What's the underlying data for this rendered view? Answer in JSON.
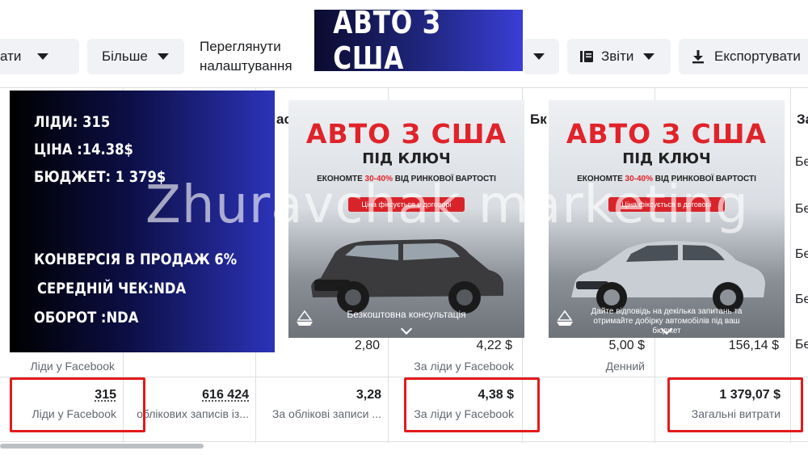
{
  "toolbar": {
    "edit_partial": "ати",
    "more_label": "Більше",
    "view_settings": "Переглянути налаштування",
    "reports_label": "Звіти",
    "export_label": "Експортувати"
  },
  "banner": {
    "title": "АВТО З США"
  },
  "stats": {
    "leads": "ЛІДИ: 315",
    "price": "ЦІНА :14.38$",
    "budget": "БЮДЖЕТ: 1 379$",
    "conversion": "КОНВЕРСІЯ В ПРОДАЖ 6%",
    "avg_check": "СЕРЕДНІЙ ЧЕК:NDA",
    "turnover": "ОБОРОТ :NDA"
  },
  "ads": [
    {
      "title": "АВТО З США",
      "subtitle": "ПІД КЛЮЧ",
      "econ_prefix": "ЕКОНОМТЕ ",
      "econ_pct": "30-40%",
      "econ_suffix": " ВІД РИНКОВОЇ ВАРТОСТІ",
      "pill": "Ціна фіксується в договорі",
      "caption": "Безкоштовна консультація",
      "logo": "GLOBAL",
      "car_color": "#3b3b3d"
    },
    {
      "title": "АВТО З США",
      "subtitle": "ПІД КЛЮЧ",
      "econ_prefix": "ЕКОНОМТЕ ",
      "econ_pct": "30-40%",
      "econ_suffix": " ВІД РИНКОВОЇ ВАРТОСТІ",
      "pill": "Ціна фіксується в договорі",
      "caption": "Дайте відповідь на декілька запитань та отримайте добірку автомобілів під ваш бюджет",
      "logo": "GLOBAL",
      "car_color": "#c9ced4"
    }
  ],
  "watermark": "Zhuravchak marketing",
  "table": {
    "headers": {
      "col2_partial": "ас",
      "col4_partial": "Бк",
      "col7_partial": "За"
    },
    "side_rows": [
      "Бе",
      "Бе",
      "Бе",
      "Бе",
      "Бе"
    ],
    "row_last": {
      "leads_label": "Ліди у Facebook",
      "freq": "2,80",
      "cpl": "4,22 $",
      "cpl_label": "За ліди у Facebook",
      "budget": "5,00 $",
      "budget_label": "Денний",
      "spent": "156,14 $"
    },
    "totals": {
      "leads": "315",
      "leads_label": "Ліди у Facebook",
      "accounts": "616 424",
      "accounts_label": "облікових записів із...",
      "cost_per_account": "3,28",
      "cost_per_account_label": "За облікові записи ...",
      "cpl": "4,38 $",
      "cpl_label": "За ліди у Facebook",
      "spent": "1 379,07 $",
      "spent_label": "Загальні витрати"
    }
  },
  "colors": {
    "highlight": "#e21b1b",
    "ad_red": "#e0232a",
    "banner_dark": "#0b0b2e",
    "banner_blue": "#3a3ed6"
  }
}
